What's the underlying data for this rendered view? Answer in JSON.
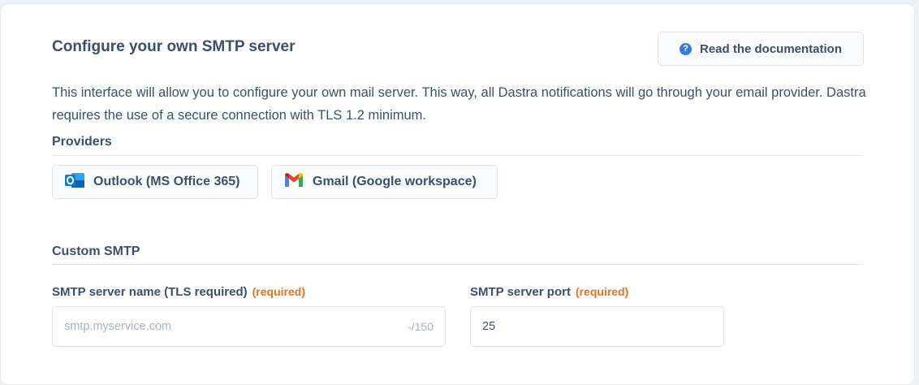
{
  "header": {
    "title": "Configure your own SMTP server",
    "doc_button_label": "Read the documentation"
  },
  "description": "This interface will allow you to configure your own mail server. This way, all Dastra notifications will go through your email provider. Dastra requires the use of a secure connection with TLS 1.2 minimum.",
  "providers": {
    "heading": "Providers",
    "items": [
      {
        "label": "Outlook (MS Office 365)",
        "icon": "outlook-icon"
      },
      {
        "label": "Gmail (Google workspace)",
        "icon": "gmail-icon"
      }
    ]
  },
  "custom_smtp": {
    "heading": "Custom SMTP",
    "server_name": {
      "label": "SMTP server name (TLS required)",
      "required_text": "(required)",
      "placeholder": "smtp.myservice.com",
      "value": "",
      "counter": "-/150"
    },
    "server_port": {
      "label": "SMTP server port",
      "required_text": "(required)",
      "value": "25"
    }
  },
  "colors": {
    "accent": "#2f7de1",
    "required": "#e0741f",
    "text": "#3d4f6b"
  }
}
